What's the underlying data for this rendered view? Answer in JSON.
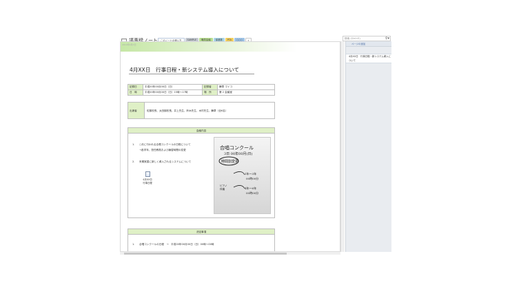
{
  "app": {
    "notebook_title": "議事録ノート",
    "tabs": [
      {
        "label": "このノートの使い方",
        "color": "#ffffff"
      },
      {
        "label": "SAMPLE",
        "color": "#c5cbd3"
      },
      {
        "label": "職員会議",
        "color": "#b8df8f"
      },
      {
        "label": "保健委",
        "color": "#a9d6e9"
      },
      {
        "label": "PTA",
        "color": "#f3cf5d"
      },
      {
        "label": "○○○",
        "color": "#9ec3e6"
      }
    ],
    "add_tab": "+",
    "search_placeholder": "検索 (Ctrl+E)"
  },
  "page_panel": {
    "add_page": "ページの追加",
    "pages": [
      "4月XX日　行事日程・新システム導入について"
    ]
  },
  "page": {
    "date_hint": "2010年4月X日",
    "title": "4月XX日　行事日程・新システム導入について",
    "info_table": [
      [
        {
          "label": "記録日",
          "value": "平成00年00月00日（日）"
        },
        {
          "label": "記録者",
          "value": "舞草 マイコ"
        }
      ],
      [
        {
          "label": "日　時",
          "value": "平成00年00月00日（日）15時～17時"
        },
        {
          "label": "場　所",
          "value": "第 2 会議室"
        }
      ]
    ],
    "attendees": {
      "label": "出席者",
      "value": "佐藤校長、太田副校長、井上先生、鈴木先生、木村先生、舞草（全6名）"
    },
    "agenda": {
      "header": "会議内容",
      "items": [
        {
          "num": "1.",
          "text": "○月に行われる合唱コンクールの日程について"
        },
        {
          "num": "",
          "text": "→各学年、担任教員および練習時間の変更"
        },
        {
          "num": "2.",
          "text": "来期実習に新しく導入されるシステムについて"
        }
      ],
      "attachment_label": "4月XX日\n行事日程"
    },
    "handwriting": {
      "line1": "合唱コンクール",
      "line2": "3日 00年00月(日)",
      "line3": "時間割変更",
      "line4": "1年～3年",
      "line5": "00時00分",
      "line6": "4年～6年",
      "line7": "00時00分",
      "side": "ピアノ\n伴奏"
    },
    "decision": {
      "header": "決定事項",
      "items": [
        {
          "num": "1.",
          "text": "合唱コンクールの日程　→　平成00年00月00日（日）00時～00時"
        }
      ]
    }
  }
}
